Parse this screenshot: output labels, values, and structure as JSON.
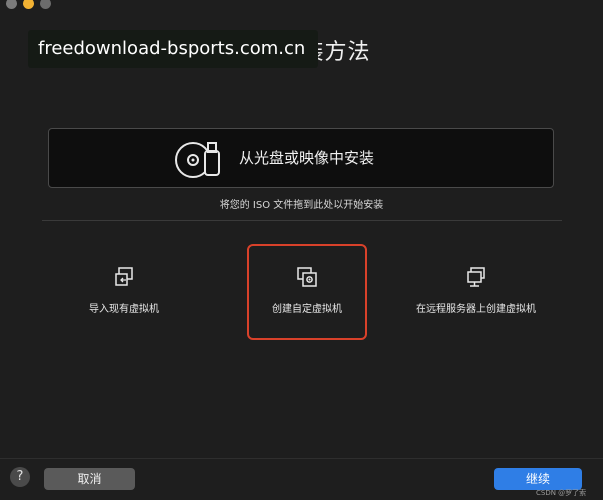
{
  "window": {
    "title": "选择安装方法"
  },
  "watermark": "freedownload-bsports.com.cn",
  "install": {
    "drop_label": "从光盘或映像中安装",
    "drop_hint": "将您的 ISO 文件拖到此处以开始安装"
  },
  "options": [
    {
      "label": "导入现有虚拟机",
      "icon": "import-vm-icon"
    },
    {
      "label": "创建自定虚拟机",
      "icon": "custom-vm-icon",
      "selected": true
    },
    {
      "label": "在远程服务器上创建虚拟机",
      "icon": "remote-vm-icon"
    }
  ],
  "footer": {
    "help_label": "?",
    "cancel_label": "取消",
    "continue_label": "继续",
    "credit": "CSDN @罗了索"
  },
  "colors": {
    "accent": "#2f7ee6",
    "selection": "#d9412a",
    "background": "#1e1e1e"
  }
}
